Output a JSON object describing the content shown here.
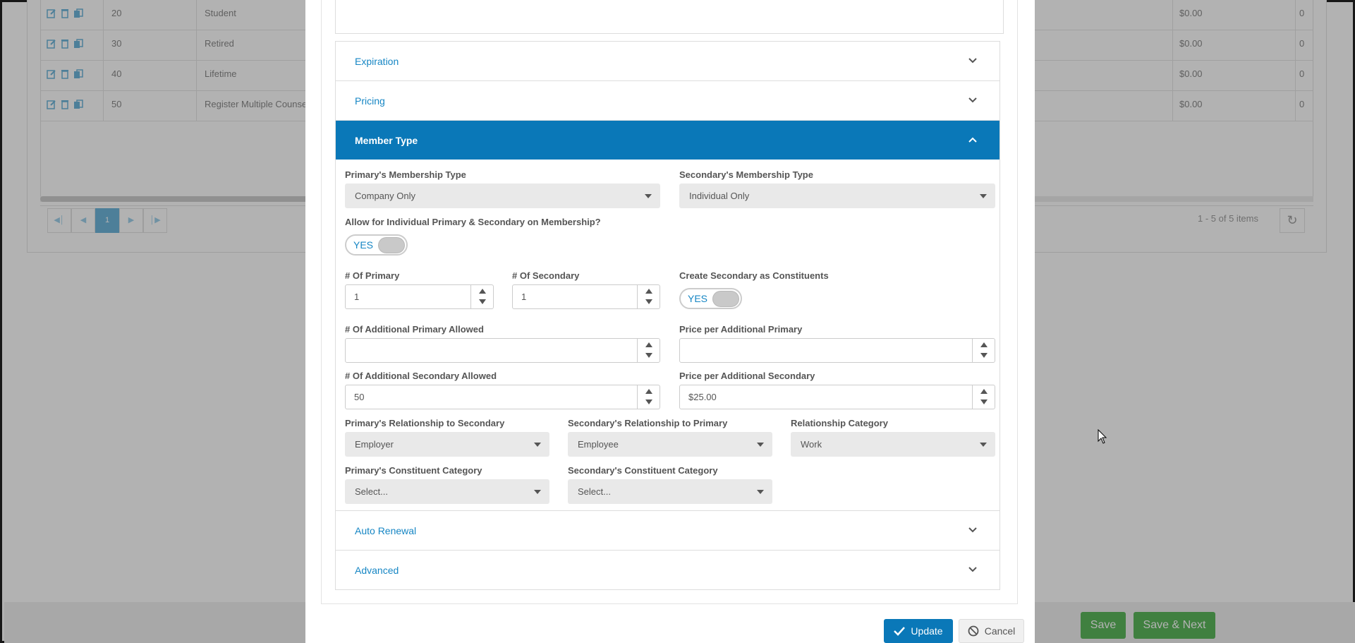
{
  "background": {
    "rows": [
      {
        "num": "20",
        "name": "Student",
        "price": "$0.00",
        "count": "0"
      },
      {
        "num": "30",
        "name": "Retired",
        "price": "$0.00",
        "count": "0"
      },
      {
        "num": "40",
        "name": "Lifetime",
        "price": "$0.00",
        "count": "0"
      },
      {
        "num": "50",
        "name": "Register Multiple Counsel",
        "price": "$0.00",
        "count": "0"
      }
    ],
    "pager": {
      "current": "1",
      "items": "1 - 5 of 5 items"
    },
    "footer": {
      "save": "Save",
      "save_next": "Save & Next"
    }
  },
  "accordion": {
    "expiration": "Expiration",
    "pricing": "Pricing",
    "member_type": "Member Type",
    "auto_renewal": "Auto Renewal",
    "advanced": "Advanced"
  },
  "form": {
    "primary_type_label": "Primary's Membership Type",
    "primary_type_value": "Company Only",
    "secondary_type_label": "Secondary's Membership Type",
    "secondary_type_value": "Individual Only",
    "allow_label": "Allow for Individual Primary & Secondary on Membership?",
    "allow_toggle": "YES",
    "num_primary_label": "# Of Primary",
    "num_primary_value": "1",
    "num_secondary_label": "# Of Secondary",
    "num_secondary_value": "1",
    "create_secondary_label": "Create Secondary as Constituents",
    "create_secondary_toggle": "YES",
    "add_primary_label": "# Of Additional Primary Allowed",
    "add_primary_value": "",
    "price_add_primary_label": "Price per Additional Primary",
    "price_add_primary_value": "",
    "add_secondary_label": "# Of Additional Secondary Allowed",
    "add_secondary_value": "50",
    "price_add_secondary_label": "Price per Additional Secondary",
    "price_add_secondary_value": "$25.00",
    "primary_rel_label": "Primary's Relationship to Secondary",
    "primary_rel_value": "Employer",
    "secondary_rel_label": "Secondary's Relationship to Primary",
    "secondary_rel_value": "Employee",
    "rel_category_label": "Relationship Category",
    "rel_category_value": "Work",
    "primary_const_label": "Primary's Constituent Category",
    "primary_const_value": "Select...",
    "secondary_const_label": "Secondary's Constituent Category",
    "secondary_const_value": "Select..."
  },
  "buttons": {
    "update": "Update",
    "cancel": "Cancel"
  },
  "colors": {
    "accent": "#0a78b8",
    "link": "#1686c4",
    "success": "#5cb85c"
  }
}
